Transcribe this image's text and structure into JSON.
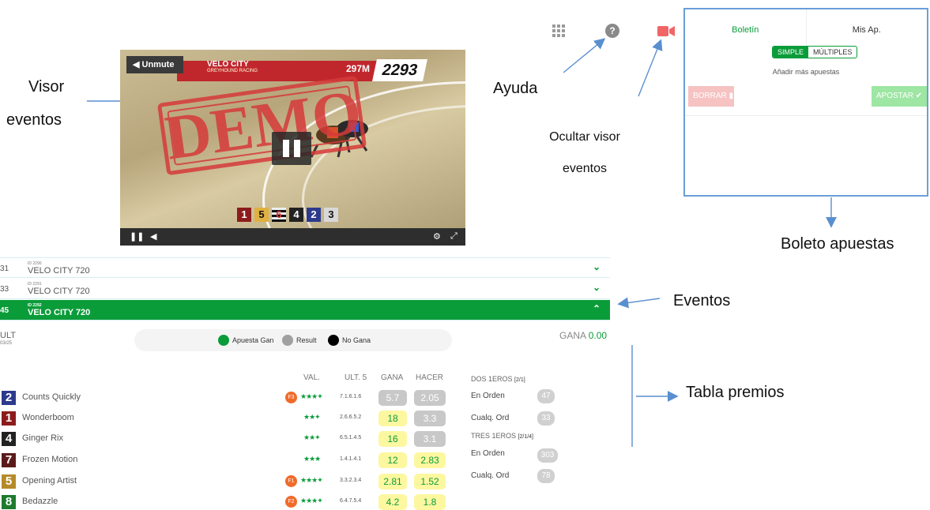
{
  "annotations": {
    "visor": [
      "Visor",
      "eventos"
    ],
    "ayuda": "Ayuda",
    "ocultar": [
      "Ocultar visor",
      "eventos"
    ],
    "boleto": "Boleto apuestas",
    "eventos": "Eventos",
    "tabla": "Tabla premios"
  },
  "video": {
    "unmute": "Unmute",
    "title": "VELO CITY",
    "subtitle": "GREYHOUND RACING",
    "distance": "297M",
    "race_number": "2293",
    "stamp": "DEMO",
    "runner_boxes": [
      "1",
      "5",
      "6",
      "4",
      "2",
      "3"
    ]
  },
  "slip": {
    "tab_boletin": "Boletín",
    "tab_mis": "Mis Ap.",
    "simple": "SIMPLE",
    "multiples": "MÚLTIPLES",
    "add_more": "Añadir más apuestas",
    "delete": "BORRAR",
    "bet": "APOSTAR"
  },
  "events": [
    {
      "num": "31",
      "id": "ID 2290",
      "name": "VELO CITY 720",
      "active": false
    },
    {
      "num": "33",
      "id": "ID 2291",
      "name": "VELO CITY 720",
      "active": false
    },
    {
      "num": "45",
      "id": "ID 2292",
      "name": "VELO CITY 720",
      "active": true
    }
  ],
  "ult": {
    "label": "ULT",
    "sub": "03/25"
  },
  "gana_total": {
    "label": "GANA",
    "value": "0.00"
  },
  "legend": {
    "win": "Apuesta Gan",
    "result": "Result",
    "nowin": "No Gana"
  },
  "table": {
    "headers": {
      "val": "VAL.",
      "ult5": "ULT. 5",
      "gana": "GANA",
      "hacer": "HACER"
    },
    "runners": [
      {
        "num": "2",
        "name": "Counts Quickly",
        "badge": "F3",
        "stars": "★★★✦",
        "ult5": "7.1.6.1.6",
        "gana": "5.7",
        "hacer": "2.05",
        "color": "#2d3a8c",
        "gana_bg": "#c8c8c8",
        "hacer_bg": "#c8c8c8"
      },
      {
        "num": "1",
        "name": "Wonderboom",
        "badge": "",
        "stars": "★★✦",
        "ult5": "2.6.6.5.2",
        "gana": "18",
        "hacer": "3.3",
        "color": "#8c1c1c",
        "gana_bg": "#fdf7a0",
        "hacer_bg": "#c8c8c8"
      },
      {
        "num": "4",
        "name": "Ginger Rix",
        "badge": "",
        "stars": "★★✦",
        "ult5": "6.5.1.4.5",
        "gana": "16",
        "hacer": "3.1",
        "color": "#222222",
        "gana_bg": "#fdf7a0",
        "hacer_bg": "#c8c8c8"
      },
      {
        "num": "7",
        "name": "Frozen Motion",
        "badge": "",
        "stars": "★★★",
        "ult5": "1.4.1.4.1",
        "gana": "12",
        "hacer": "2.83",
        "color": "#5b1a1a",
        "gana_bg": "#fdf7a0",
        "hacer_bg": "#fdf7a0"
      },
      {
        "num": "5",
        "name": "Opening Artist",
        "badge": "F1",
        "stars": "★★★✦",
        "ult5": "3.3.2.3.4",
        "gana": "2.81",
        "hacer": "1.52",
        "color": "#b58b2a",
        "gana_bg": "#fdf7a0",
        "hacer_bg": "#fdf7a0"
      },
      {
        "num": "8",
        "name": "Bedazzle",
        "badge": "F2",
        "stars": "★★★✦",
        "ult5": "6.4.7.5.4",
        "gana": "4.2",
        "hacer": "1.8",
        "color": "#1d7a2e",
        "gana_bg": "#fdf7a0",
        "hacer_bg": "#fdf7a0"
      }
    ]
  },
  "prizes": {
    "dos_title": "DOS 1EROS",
    "dos_tag": "[2/1]",
    "tres_title": "TRES 1EROS",
    "tres_tag": "[2/1/4]",
    "en_orden": "En Orden",
    "cualq": "Cualq. Ord",
    "cualq2": "Cualq. Ord",
    "dos_orden": "47",
    "dos_cualq": "33",
    "tres_orden": "303",
    "tres_cualq": "78"
  },
  "colors": {
    "accent": "#0b9c3a",
    "slip_border": "#6a9fd8",
    "arrow": "#5a8fcf"
  }
}
